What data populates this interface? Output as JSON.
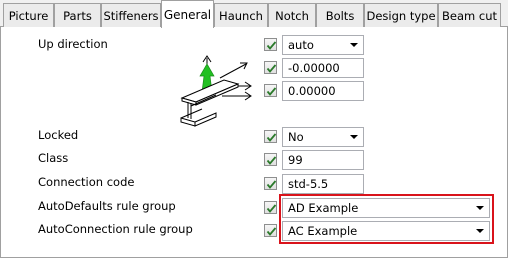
{
  "tabs": [
    {
      "label": "Picture",
      "active": false
    },
    {
      "label": "Parts",
      "active": false
    },
    {
      "label": "Stiffeners",
      "active": false
    },
    {
      "label": "General",
      "active": true
    },
    {
      "label": "Haunch",
      "active": false
    },
    {
      "label": "Notch",
      "active": false
    },
    {
      "label": "Bolts",
      "active": false
    },
    {
      "label": "Design type",
      "active": false
    },
    {
      "label": "Beam cut",
      "active": false
    }
  ],
  "up_direction": {
    "label": "Up direction",
    "mode_value": "auto",
    "x_value": "-0.00000",
    "y_value": "0.00000",
    "diagram_icon": "beam-axes-icon"
  },
  "locked": {
    "label": "Locked",
    "value": "No"
  },
  "class": {
    "label": "Class",
    "value": "99"
  },
  "connection_code": {
    "label": "Connection code",
    "value": "std-5.5"
  },
  "autodefaults": {
    "label": "AutoDefaults rule group",
    "value": "AD Example"
  },
  "autoconnection": {
    "label": "AutoConnection rule group",
    "value": "AC Example"
  },
  "colors": {
    "highlight": "#d9131b",
    "arrow_green": "#22c022",
    "checkbox_check": "#2b7a2b"
  }
}
